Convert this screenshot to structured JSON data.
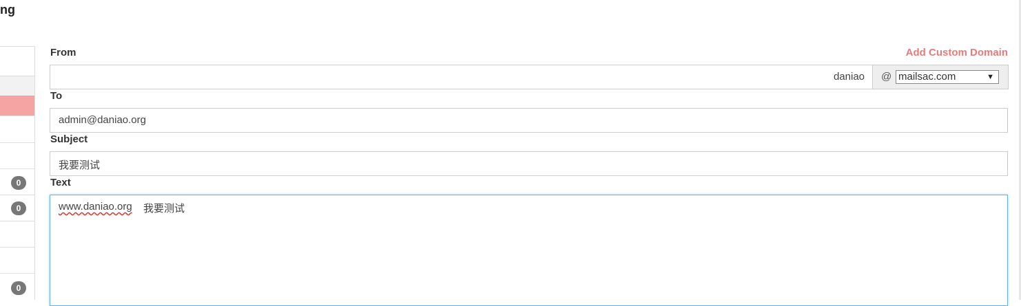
{
  "page": {
    "heading_fragment": "ng"
  },
  "sidebar": {
    "badges": [
      "0",
      "0",
      "0"
    ]
  },
  "form": {
    "from_label": "From",
    "add_custom_domain": "Add Custom Domain",
    "from_value": "daniao",
    "at_sign": "@",
    "domain_selected": "mailsac.com",
    "to_label": "To",
    "to_value": "admin@daniao.org",
    "subject_label": "Subject",
    "subject_value": "我要测试",
    "text_label": "Text",
    "text_value_link": "www.daniao.org",
    "text_value_rest": "我要测试"
  },
  "colors": {
    "accent_link": "#e87a7a",
    "sidebar_active": "#f5a3a3",
    "badge": "#777777",
    "focus_border": "#66afe9"
  }
}
